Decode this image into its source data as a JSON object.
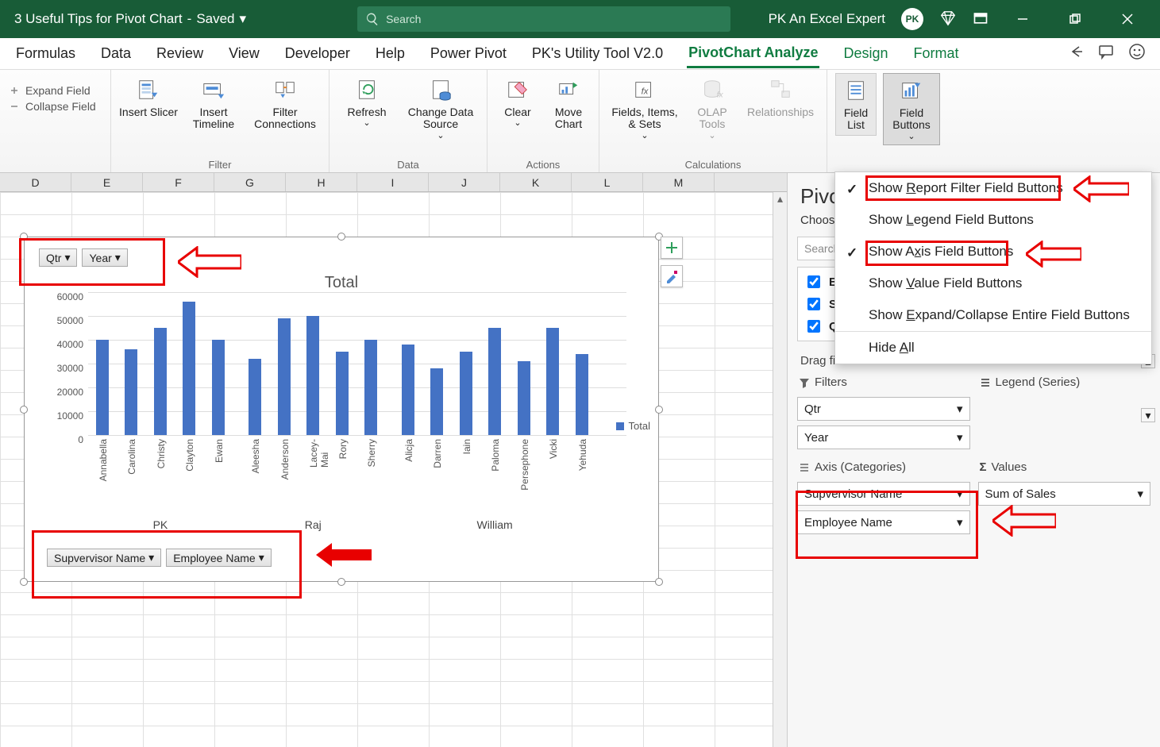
{
  "titlebar": {
    "doc_title": "3 Useful Tips for Pivot Chart",
    "saved_state": "Saved",
    "search_placeholder": "Search",
    "user_name": "PK An Excel Expert"
  },
  "tabs": {
    "items": [
      "Formulas",
      "Data",
      "Review",
      "View",
      "Developer",
      "Help",
      "Power Pivot",
      "PK's Utility Tool V2.0",
      "PivotChart Analyze",
      "Design",
      "Format"
    ],
    "active": "PivotChart Analyze"
  },
  "ribbon": {
    "expand_field": "Expand Field",
    "collapse_field": "Collapse Field",
    "insert_slicer": "Insert Slicer",
    "insert_timeline": "Insert Timeline",
    "filter_connections": "Filter Connections",
    "filter_group": "Filter",
    "refresh": "Refresh",
    "change_data_source": "Change Data Source",
    "data_group": "Data",
    "clear": "Clear",
    "move_chart": "Move Chart",
    "actions_group": "Actions",
    "fields_items_sets": "Fields, Items, & Sets",
    "olap_tools": "OLAP Tools",
    "relationships": "Relationships",
    "calculations_group": "Calculations",
    "field_list": "Field List",
    "field_buttons": "Field Buttons"
  },
  "dropdown": {
    "items": [
      {
        "label": "Show Report Filter Field Buttons",
        "checked": true,
        "accel": "R"
      },
      {
        "label": "Show Legend Field Buttons",
        "checked": false,
        "accel": "L"
      },
      {
        "label": "Show Axis Field Buttons",
        "checked": true,
        "accel": "x"
      },
      {
        "label": "Show Value Field Buttons",
        "checked": false,
        "accel": "V"
      },
      {
        "label": "Show Expand/Collapse Entire Field Buttons",
        "checked": false,
        "accel": "E"
      },
      {
        "label": "Hide All",
        "checked": false,
        "accel": "A"
      }
    ]
  },
  "columns": [
    "D",
    "E",
    "F",
    "G",
    "H",
    "I",
    "J",
    "K",
    "L",
    "M"
  ],
  "chart_buttons_top": [
    "Qtr",
    "Year"
  ],
  "chart_buttons_bottom": [
    "Supvervisor Name",
    "Employee Name"
  ],
  "chart_data": {
    "type": "bar",
    "title": "Total",
    "ylabel": "",
    "xlabel": "",
    "ylim": [
      0,
      60000
    ],
    "yticks": [
      0,
      10000,
      20000,
      30000,
      40000,
      50000,
      60000
    ],
    "legend": [
      "Total"
    ],
    "groups": [
      {
        "name": "PK",
        "categories": [
          "Annabella",
          "Carolina",
          "Christy",
          "Clayton",
          "Ewan"
        ],
        "values": [
          40000,
          36000,
          45000,
          56000,
          40000
        ]
      },
      {
        "name": "Raj",
        "categories": [
          "Aleesha",
          "Anderson",
          "Lacey-Mai",
          "Rory",
          "Sherry"
        ],
        "values": [
          32000,
          49000,
          50000,
          35000,
          40000
        ]
      },
      {
        "name": "William",
        "categories": [
          "Alicja",
          "Darren",
          "Iain",
          "Paloma",
          "Persephone",
          "Vicki",
          "Yehuda"
        ],
        "values": [
          38000,
          28000,
          35000,
          45000,
          31000,
          45000,
          34000
        ]
      }
    ]
  },
  "task_pane": {
    "title": "PivotC",
    "subtitle": "Choose f",
    "search_placeholder": "Search",
    "fields": [
      {
        "label": "Employee Name",
        "checked": true
      },
      {
        "label": "Supvervisor Name",
        "checked": true
      },
      {
        "label": "Qtr",
        "checked": true
      }
    ],
    "drag_caption": "Drag fields between areas below:",
    "filters_label": "Filters",
    "legend_label": "Legend (Series)",
    "axis_label": "Axis (Categories)",
    "values_label": "Values",
    "filters": [
      "Qtr",
      "Year"
    ],
    "axis": [
      "Supvervisor Name",
      "Employee Name"
    ],
    "values": [
      "Sum of Sales"
    ]
  }
}
